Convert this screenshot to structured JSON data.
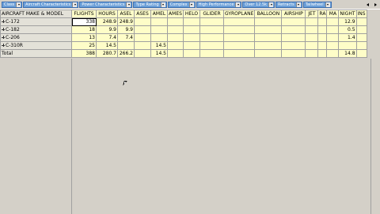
{
  "filters": [
    "Class",
    "Aircraft Characteristics",
    "Power Characteristics",
    "Type Rating",
    "Complex",
    "High Performance",
    "Over 12.5k",
    "Retracts",
    "Tailwheel"
  ],
  "grid": {
    "row_header_label": "AIRCRAFT MAKE & MODEL",
    "columns": [
      "FLIGHTS",
      "HOURS",
      "ASEL",
      "ASES",
      "AMEL",
      "AMES",
      "HELO",
      "GLIDER",
      "GYROPLANE",
      "BALLOON",
      "AIRSHIP",
      "JET",
      "RA",
      "MA",
      "NIGHT",
      "INS"
    ],
    "rows": [
      {
        "label": "C-172",
        "cells": [
          "338",
          "248.9",
          "248.9",
          "",
          "",
          "",
          "",
          "",
          "",
          "",
          "",
          "",
          "",
          "",
          "12.9",
          ""
        ]
      },
      {
        "label": "C-182",
        "cells": [
          "18",
          "9.9",
          "9.9",
          "",
          "",
          "",
          "",
          "",
          "",
          "",
          "",
          "",
          "",
          "",
          "0.5",
          ""
        ]
      },
      {
        "label": "C-206",
        "cells": [
          "13",
          "7.4",
          "7.4",
          "",
          "",
          "",
          "",
          "",
          "",
          "",
          "",
          "",
          "",
          "",
          "1.4",
          ""
        ]
      },
      {
        "label": "C-310R",
        "cells": [
          "25",
          "14.5",
          "",
          "",
          "14.5",
          "",
          "",
          "",
          "",
          "",
          "",
          "",
          "",
          "",
          "",
          ""
        ]
      }
    ],
    "total": {
      "label": "Total",
      "cells": [
        "388",
        "280.7",
        "266.2",
        "",
        "14.5",
        "",
        "",
        "",
        "",
        "",
        "",
        "",
        "",
        "",
        "14.8",
        ""
      ]
    }
  },
  "icons": {
    "row_icon": "airplane-icon",
    "cursor": "mouse-pointer-icon"
  },
  "colors": {
    "chip_bg": "#6b9fd8",
    "cell_bg": "#fefdc8",
    "panel_bg": "#d4d0c8"
  }
}
